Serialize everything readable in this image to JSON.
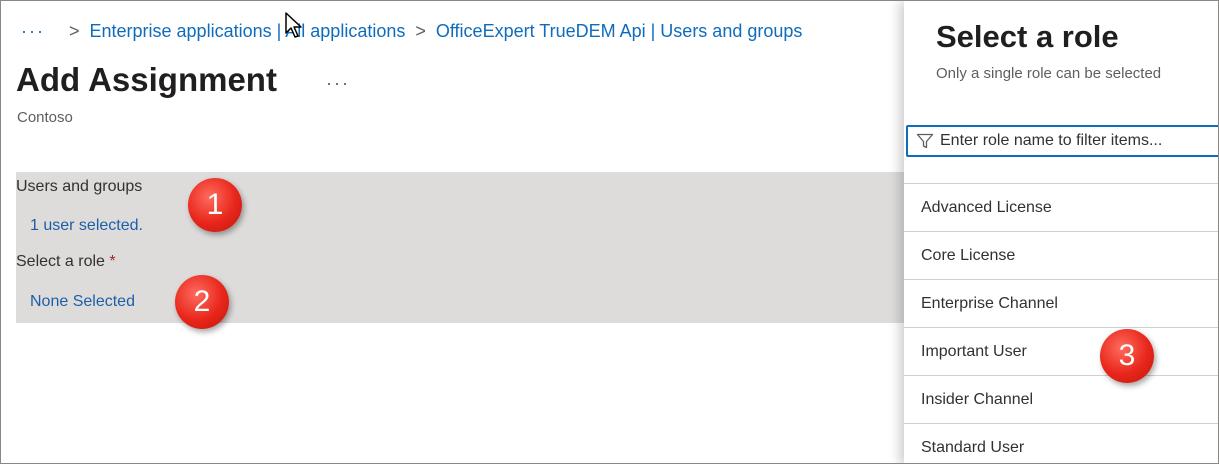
{
  "breadcrumb": {
    "ellipsis": "···",
    "separator": ">",
    "items": [
      "Enterprise applications | All applications",
      "OfficeExpert TrueDEM Api | Users and groups"
    ]
  },
  "page": {
    "title": "Add Assignment",
    "more": "···",
    "subtitle": "Contoso"
  },
  "assignment": {
    "users_label": "Users and groups",
    "users_value": "1 user selected.",
    "role_label": "Select a role",
    "role_required": "*",
    "role_value": "None Selected"
  },
  "callouts": [
    "1",
    "2",
    "3"
  ],
  "role_panel": {
    "title": "Select a role",
    "subtitle": "Only a single role can be selected",
    "filter_placeholder": "Enter role name to filter items...",
    "roles": [
      "Advanced License",
      "Core License",
      "Enterprise Channel",
      "Important User",
      "Insider Channel",
      "Standard User"
    ]
  },
  "colors": {
    "link": "#0f6cbd",
    "panel_bg": "#dedcdb",
    "badge": "#e8261b"
  }
}
